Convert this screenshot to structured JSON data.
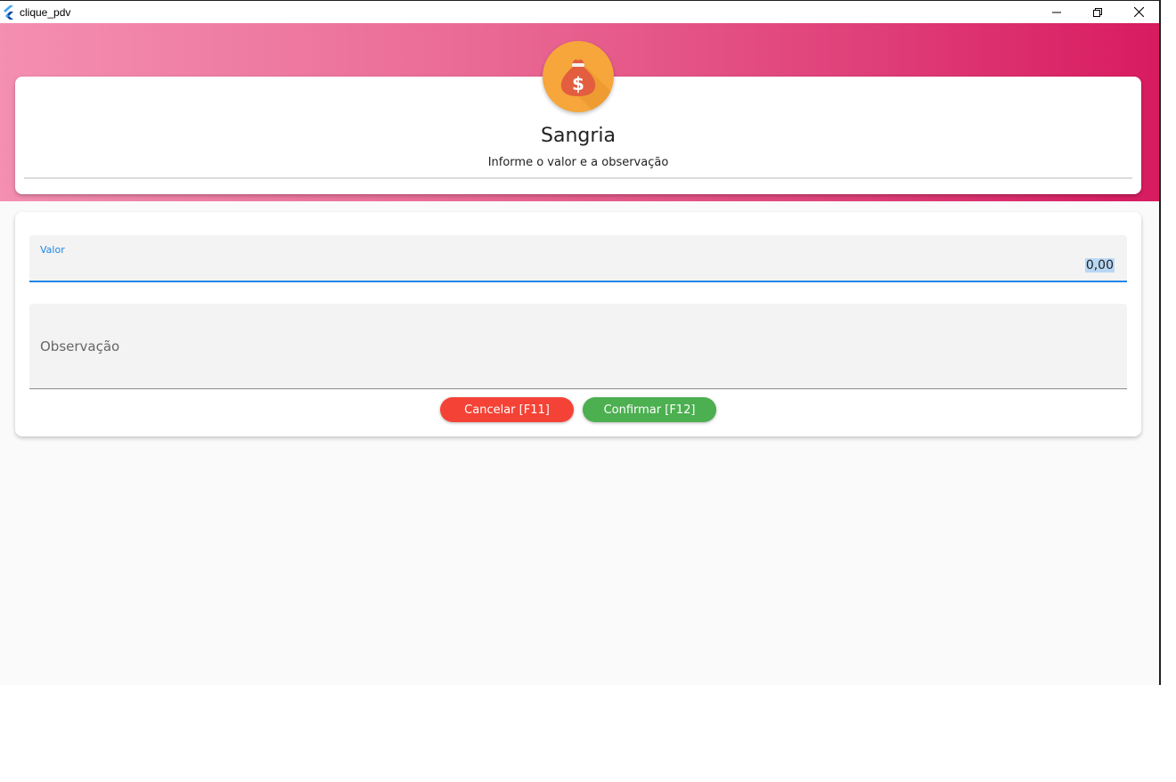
{
  "window": {
    "title": "clique_pdv",
    "controls": {
      "minimize": "minimize-icon",
      "restore": "restore-icon",
      "close": "close-icon"
    }
  },
  "header": {
    "icon": "money-bag-icon",
    "title": "Sangria",
    "subtitle": "Informe o valor e a observação"
  },
  "form": {
    "valor": {
      "label": "Valor",
      "value": "0,00"
    },
    "observacao": {
      "label": "Observação",
      "value": ""
    },
    "cancel_label": "Cancelar [F11]",
    "confirm_label": "Confirmar [F12]"
  },
  "colors": {
    "header_gradient_start": "#f48fb1",
    "header_gradient_end": "#d81b60",
    "avatar": "#f6a63a",
    "bag": "#e35d3f",
    "accent": "#1e88e5",
    "cancel": "#f44336",
    "confirm": "#4caf50"
  }
}
